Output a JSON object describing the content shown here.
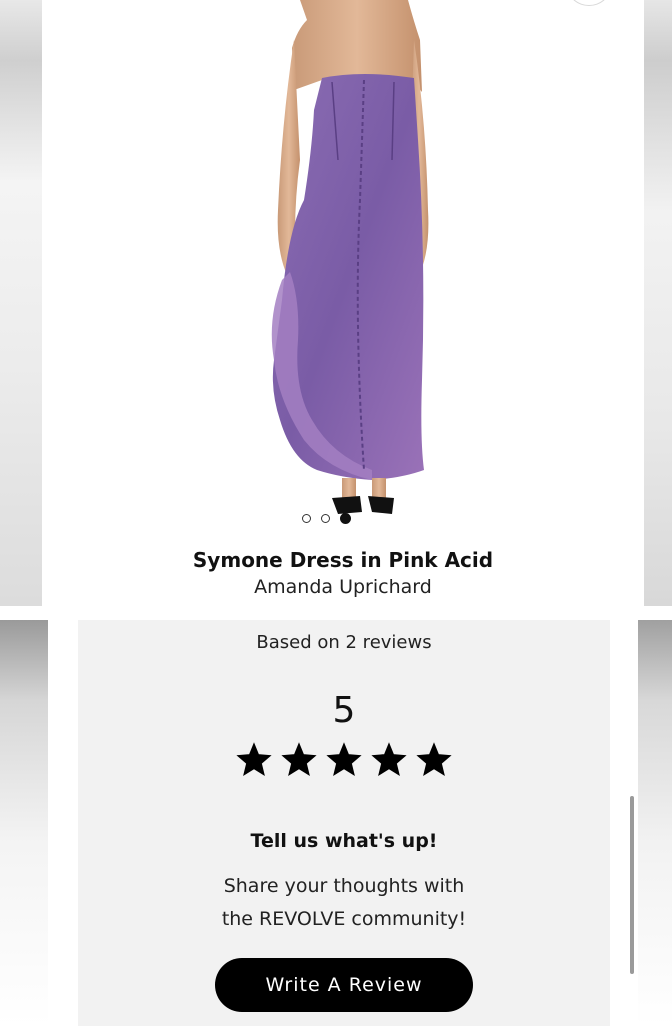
{
  "product": {
    "name": "Symone Dress in Pink Acid",
    "brand": "Amanda Uprichard",
    "image_dots": 3,
    "active_image_index": 2,
    "dress_color": "#7d5fa6"
  },
  "reviews": {
    "count_text": "Based on 2 reviews",
    "average_rating": "5",
    "stars_filled": 5,
    "stars_total": 5,
    "cta_title": "Tell us what's up!",
    "cta_line1": "Share your thoughts with",
    "cta_line2": "the REVOLVE community!",
    "write_review_label": "Write A Review"
  }
}
